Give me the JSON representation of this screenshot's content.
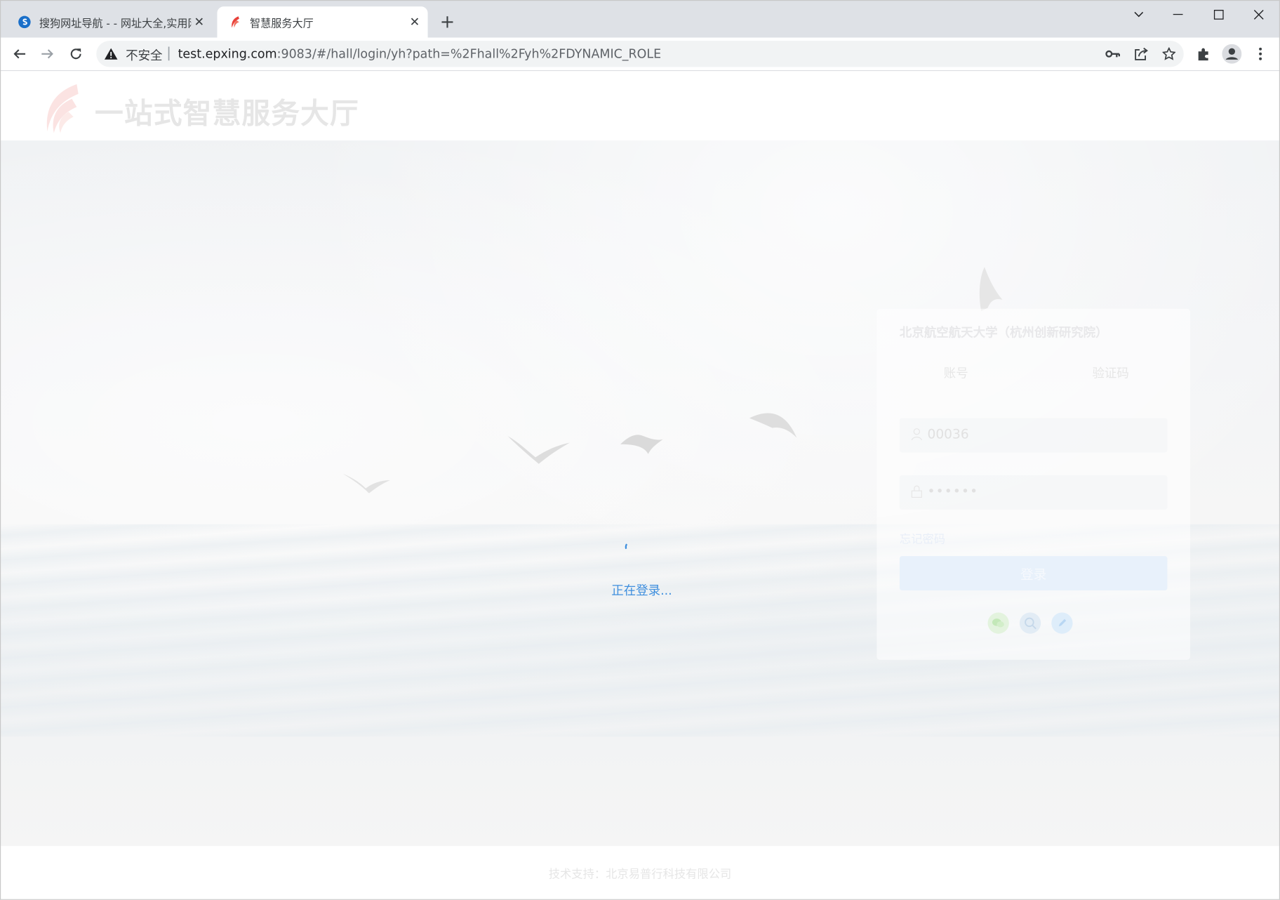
{
  "browser": {
    "tabs": [
      {
        "title": "搜狗网址导航 - - 网址大全,实用网址",
        "icon": "sogou-icon",
        "active": false
      },
      {
        "title": "智慧服务大厅",
        "icon": "flame-logo-icon",
        "active": true
      }
    ],
    "security_label": "不安全",
    "url_host": "test.epxing.com",
    "url_rest": ":9083/#/hall/login/yh?path=%2Fhall%2Fyh%2FDYNAMIC_ROLE"
  },
  "page": {
    "site_title": "一站式智慧服务大厅",
    "loading_text": "正在登录...",
    "login": {
      "org_name": "北京航空航天大学（杭州创新研究院）",
      "tab_account": "账号",
      "tab_code": "验证码",
      "username_value": "00036",
      "password_mask": "••••••",
      "forgot_label": "忘记密码",
      "submit_label": "登录"
    },
    "footer": "技术支持：北京易普行科技有限公司"
  },
  "colors": {
    "accent": "#3f8fde",
    "logo_red": "#e8413a",
    "wechat_green": "#6fcf5e",
    "qq_blue": "#4aa5e8"
  }
}
